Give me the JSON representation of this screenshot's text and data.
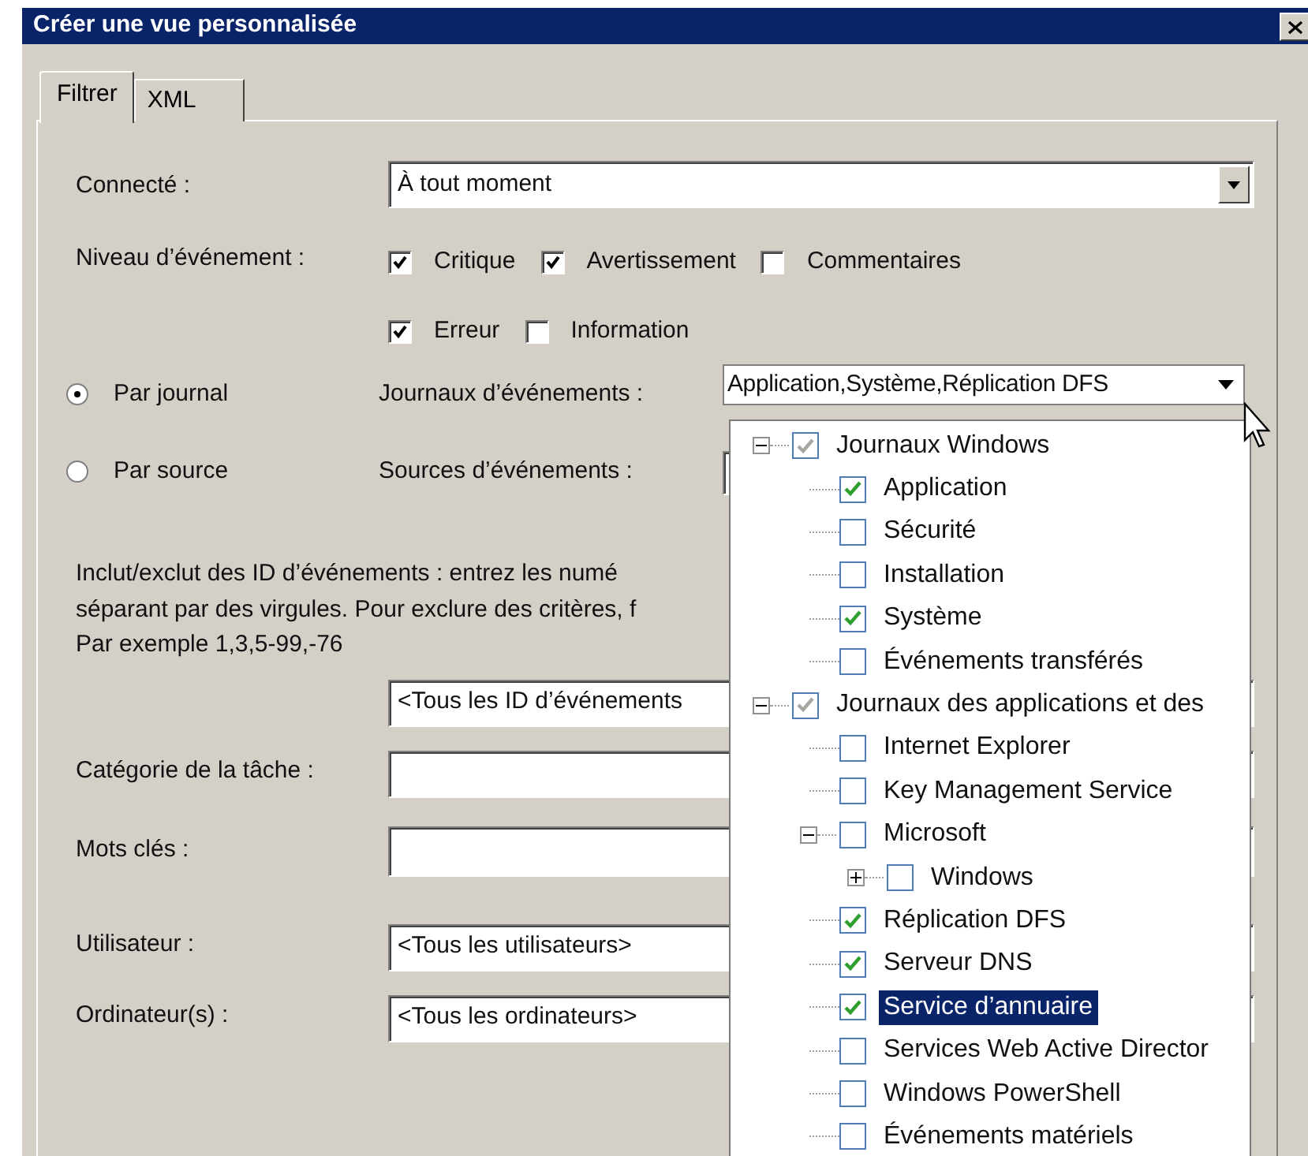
{
  "window": {
    "title": "Créer une vue personnalisée"
  },
  "tabs": [
    {
      "label": "Filtrer",
      "selected": true
    },
    {
      "label": "XML",
      "selected": false
    }
  ],
  "logged": {
    "label": "Connecté :",
    "value": "À tout moment"
  },
  "event_level": {
    "label": "Niveau d’événement :",
    "options": [
      {
        "label": "Critique",
        "checked": true
      },
      {
        "label": "Avertissement",
        "checked": true
      },
      {
        "label": "Commentaires",
        "checked": false
      },
      {
        "label": "Erreur",
        "checked": true
      },
      {
        "label": "Information",
        "checked": false
      }
    ]
  },
  "scope": [
    {
      "label": "Par journal",
      "selected": true,
      "field_label": "Journaux d’événements :",
      "value": "Application,Système,Réplication DFS"
    },
    {
      "label": "Par source",
      "selected": false,
      "field_label": "Sources d’événements :"
    }
  ],
  "event_ids": {
    "help_lines": [
      "Inclut/exclut des ID d’événements : entrez les numé",
      "séparant par des virgules. Pour exclure des critères, f",
      "Par exemple 1,3,5-99,-76"
    ],
    "value": "<Tous les ID d’événements"
  },
  "fields": [
    {
      "label": "Catégorie de la tâche :"
    },
    {
      "label": "Mots clés :"
    },
    {
      "label": "Utilisateur :",
      "value": "<Tous les utilisateurs>"
    },
    {
      "label": "Ordinateur(s) :",
      "value": "<Tous les ordinateurs>"
    }
  ],
  "log_tree": [
    {
      "label": "Journaux Windows",
      "checked": true,
      "mixed": true,
      "expanded": true,
      "selected": false,
      "children": [
        {
          "label": "Application",
          "checked": true,
          "selected": false
        },
        {
          "label": "Sécurité",
          "checked": false,
          "selected": false
        },
        {
          "label": "Installation",
          "checked": false,
          "selected": false
        },
        {
          "label": "Système",
          "checked": true,
          "selected": false
        },
        {
          "label": "Événements transférés",
          "checked": false,
          "selected": false
        }
      ]
    },
    {
      "label": "Journaux des applications et des",
      "checked": true,
      "mixed": true,
      "expanded": true,
      "selected": false,
      "children": [
        {
          "label": "Internet Explorer",
          "checked": false,
          "selected": false
        },
        {
          "label": "Key Management Service",
          "checked": false,
          "selected": false
        },
        {
          "label": "Microsoft",
          "checked": false,
          "expanded": true,
          "selected": false,
          "children": [
            {
              "label": "Windows",
              "checked": false,
              "expanded": false,
              "selected": false
            }
          ]
        },
        {
          "label": "Réplication DFS",
          "checked": true,
          "selected": false
        },
        {
          "label": "Serveur DNS",
          "checked": true,
          "selected": false
        },
        {
          "label": "Service d’annuaire",
          "checked": true,
          "selected": true
        },
        {
          "label": "Services Web Active Director",
          "checked": false,
          "selected": false
        },
        {
          "label": "Windows PowerShell",
          "checked": false,
          "selected": false
        },
        {
          "label": "Événements matériels",
          "checked": false,
          "selected": false
        }
      ]
    }
  ]
}
